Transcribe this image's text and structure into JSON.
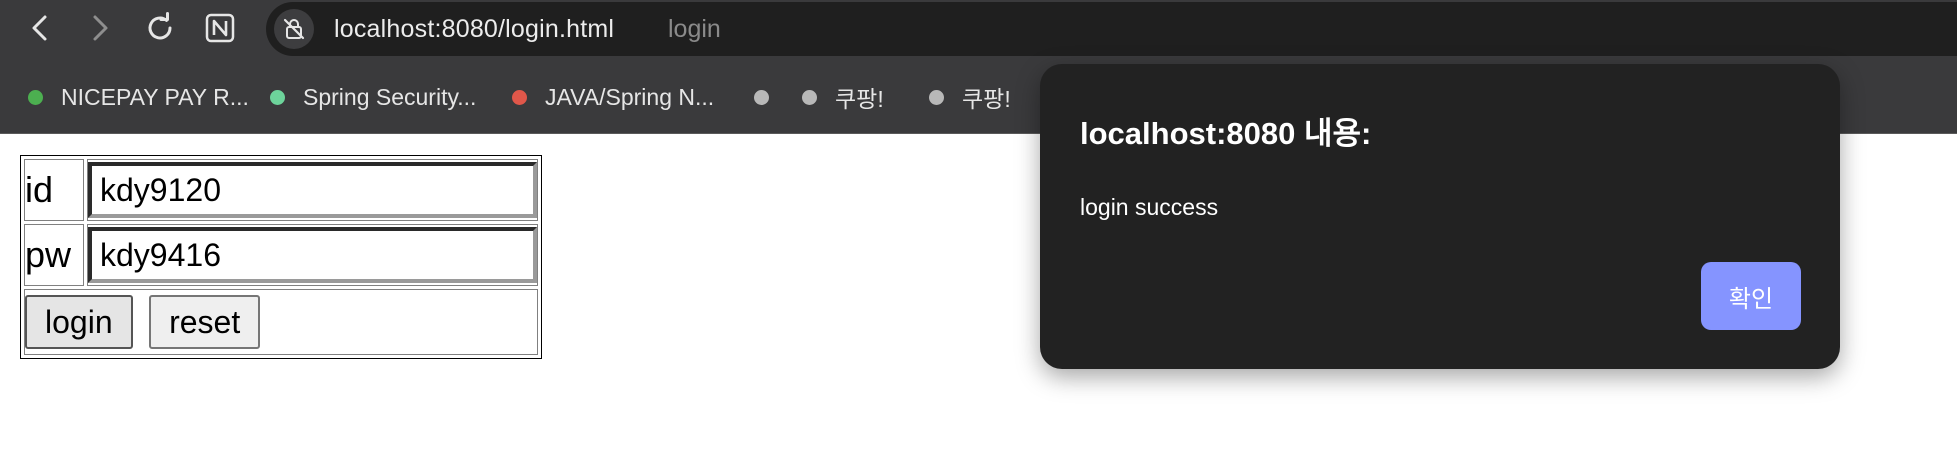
{
  "browser": {
    "url": "localhost:8080/login.html",
    "page_title": "login",
    "nav": {
      "back_icon": "chevron-left-icon",
      "forward_icon": "chevron-right-icon",
      "reload_icon": "reload-icon",
      "extension_icon": "notion-n-icon"
    },
    "site_icon": "not-secure-lock-icon"
  },
  "bookmarks": [
    {
      "label": "NICEPAY PAY R...",
      "color": "#4caf50"
    },
    {
      "label": "Spring Security...",
      "color": "#6dd39b"
    },
    {
      "label": "JAVA/Spring N...",
      "color": "#e0574a"
    },
    {
      "label": "",
      "color": "#b8b8b8"
    },
    {
      "label": "쿠팡!",
      "color": "#b8b8b8"
    },
    {
      "label": "쿠팡!",
      "color": "#b8b8b8"
    }
  ],
  "form": {
    "id_label": "id",
    "id_value": "kdy9120",
    "pw_label": "pw",
    "pw_value": "kdy9416",
    "login_label": "login",
    "reset_label": "reset"
  },
  "dialog": {
    "title": "localhost:8080 내용:",
    "message": "login success",
    "ok_label": "확인",
    "ok_color": "#8594ff"
  }
}
